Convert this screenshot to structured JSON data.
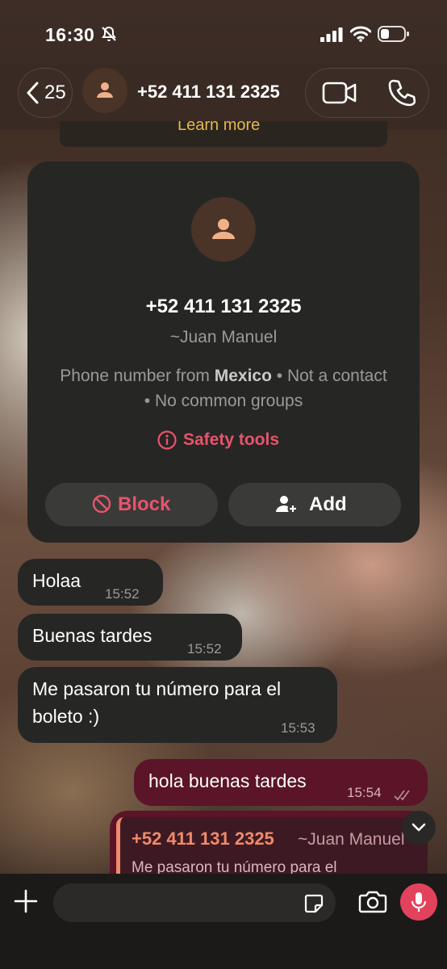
{
  "status_bar": {
    "time": "16:30"
  },
  "header": {
    "back_count": "25",
    "title": "+52 411 131 2325"
  },
  "banner": {
    "learn_more": "Learn more"
  },
  "card": {
    "number": "+52 411 131 2325",
    "name": "~Juan Manuel",
    "info_pre": "Phone number from ",
    "info_country": "Mexico",
    "info_post": " • Not a contact • No common groups",
    "safety_tools": "Safety tools",
    "block_label": "Block",
    "add_label": "Add"
  },
  "messages": [
    {
      "text": "Holaa",
      "time": "15:52"
    },
    {
      "text": "Buenas tardes",
      "time": "15:52"
    },
    {
      "text_line1": "Me pasaron tu número para el",
      "text_line2": "boleto :)",
      "time": "15:53"
    }
  ],
  "outgoing": {
    "text": "hola buenas tardes",
    "time": "15:54"
  },
  "reply": {
    "number": "+52 411 131 2325",
    "name": "~Juan Manuel",
    "text": "Me pasaron tu número para el"
  },
  "composer": {
    "placeholder": ""
  },
  "colors": {
    "accent_red": "#e9546b",
    "outgoing_bubble": "#5b1428",
    "incoming_bubble": "#262625",
    "mic_button": "#e2425c"
  }
}
